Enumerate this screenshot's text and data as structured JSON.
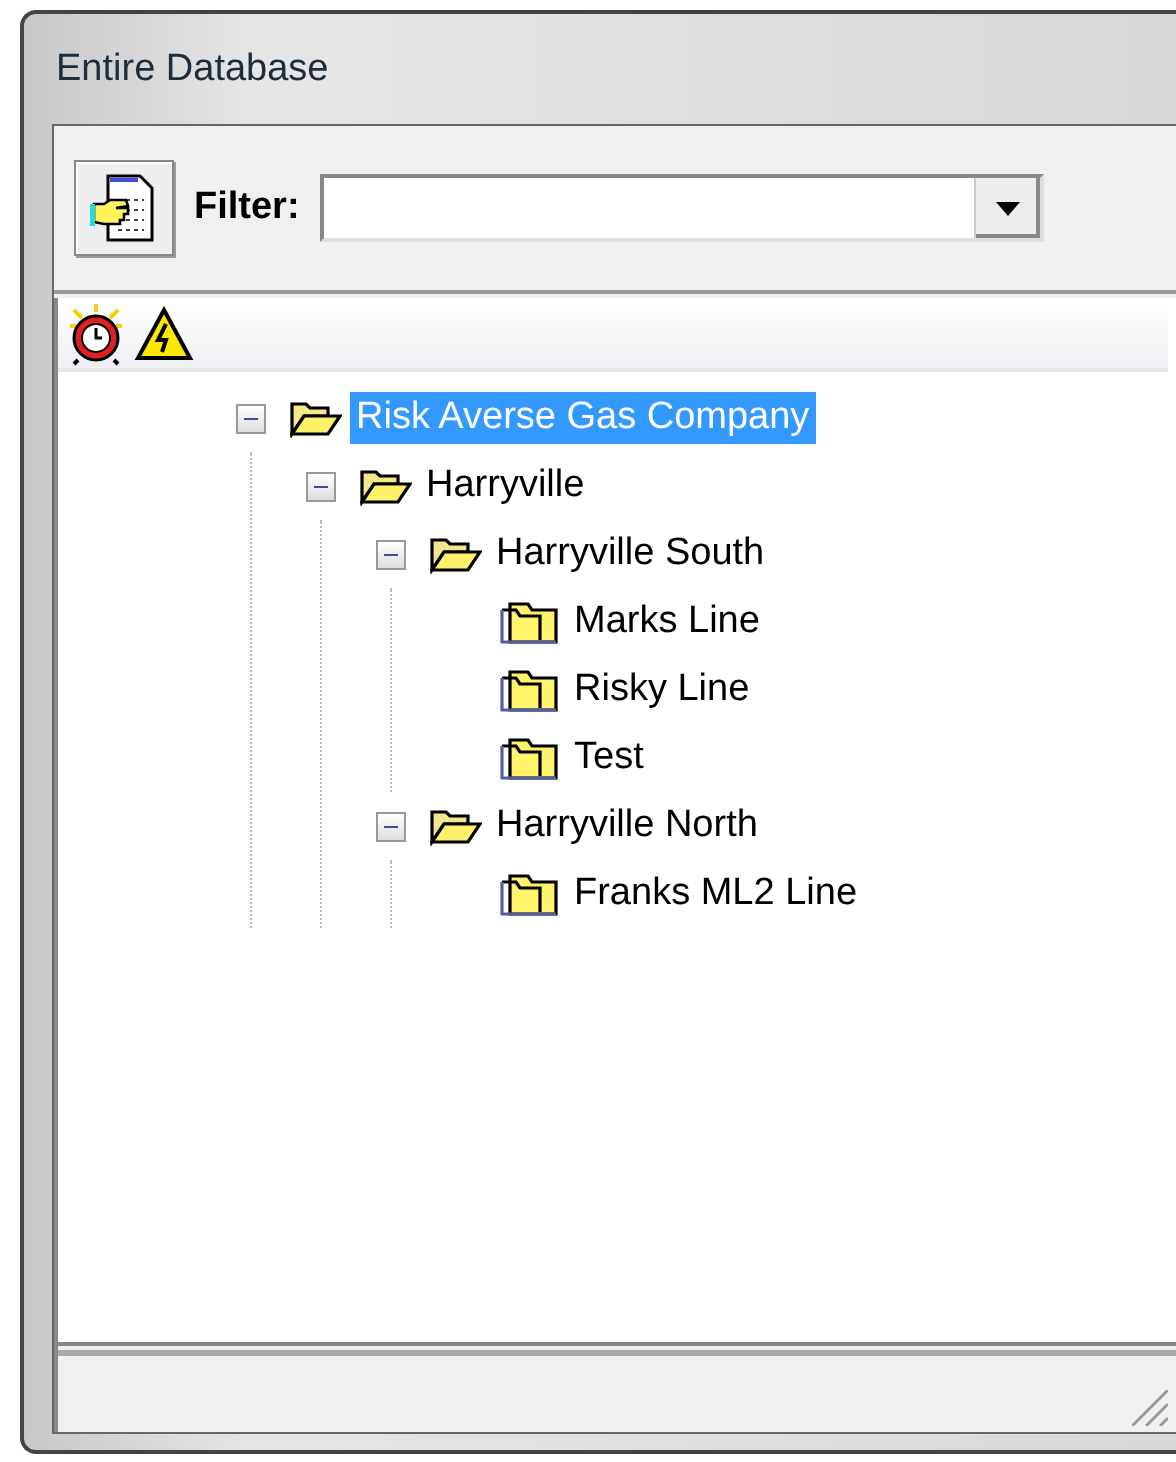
{
  "window": {
    "title": "Entire Database"
  },
  "toolbar": {
    "filter_label": "Filter:"
  },
  "tree": [
    {
      "label": "Risk Averse Gas Company",
      "kind": "folder",
      "expanded": true,
      "selected": true,
      "children": [
        {
          "label": "Harryville",
          "kind": "folder",
          "expanded": true,
          "selected": false,
          "children": [
            {
              "label": "Harryville South",
              "kind": "folder",
              "expanded": true,
              "selected": false,
              "children": [
                {
                  "label": "Marks Line",
                  "kind": "line",
                  "selected": false
                },
                {
                  "label": "Risky Line",
                  "kind": "line",
                  "selected": false
                },
                {
                  "label": "Test",
                  "kind": "line",
                  "selected": false
                }
              ]
            },
            {
              "label": "Harryville North",
              "kind": "folder",
              "expanded": true,
              "selected": false,
              "children": [
                {
                  "label": "Franks ML2 Line",
                  "kind": "line",
                  "selected": false
                }
              ]
            }
          ]
        }
      ]
    }
  ]
}
